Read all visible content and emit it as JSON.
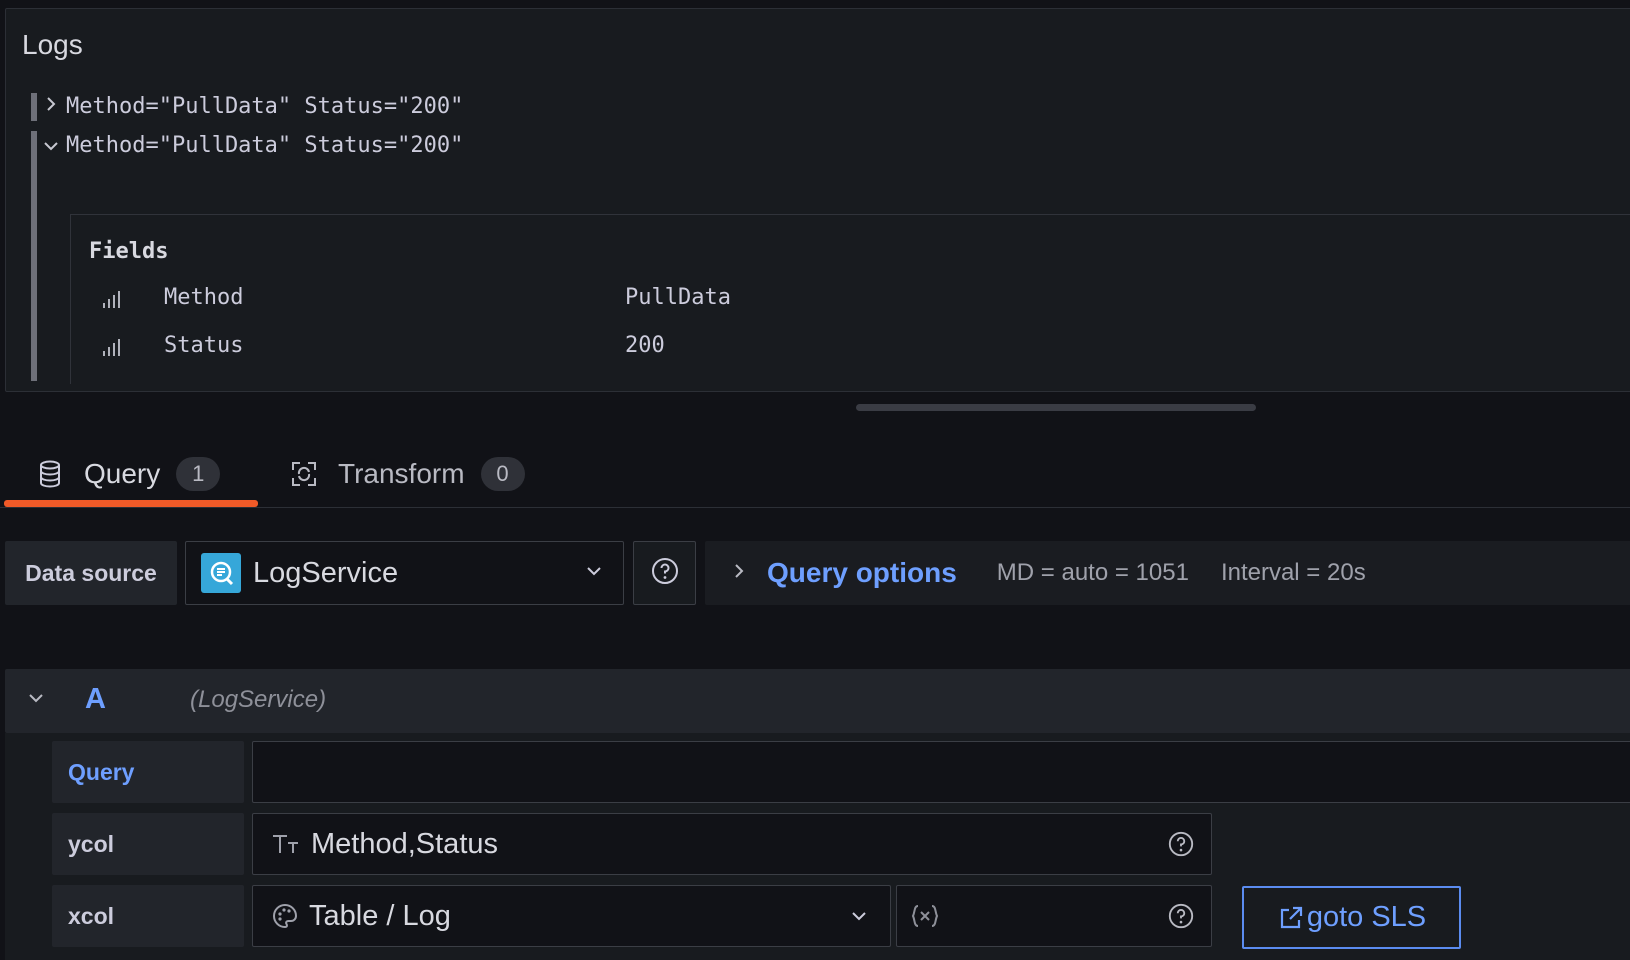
{
  "logs_panel": {
    "title": "Logs",
    "rows": [
      {
        "text": "Method=\"PullData\" Status=\"200\"",
        "expanded": false
      },
      {
        "text": "Method=\"PullData\" Status=\"200\"",
        "expanded": true
      }
    ],
    "details": {
      "title": "Fields",
      "fields": [
        {
          "name": "Method",
          "value": "PullData"
        },
        {
          "name": "Status",
          "value": "200"
        }
      ]
    }
  },
  "tabs": [
    {
      "label": "Query",
      "count": "1",
      "icon": "database-icon",
      "active": true
    },
    {
      "label": "Transform",
      "count": "0",
      "icon": "transform-icon",
      "active": false
    }
  ],
  "datasource": {
    "label": "Data source",
    "selected": "LogService",
    "help_icon": "question-circle-icon"
  },
  "query_options": {
    "title": "Query options",
    "md_info": "MD = auto = 1051",
    "interval_info": "Interval = 20s"
  },
  "query_row": {
    "ref_id": "A",
    "datasource_name": "(LogService)",
    "fields": {
      "query_label": "Query",
      "query_value": "",
      "ycol_label": "ycol",
      "ycol_value": "Method,Status",
      "xcol_label": "xcol",
      "xcol_value": "Table / Log"
    },
    "goto_label": "goto SLS"
  },
  "colors": {
    "accent": "#f05a28",
    "link": "#6e9fff",
    "background": "#111217",
    "panel": "#181b1f"
  }
}
